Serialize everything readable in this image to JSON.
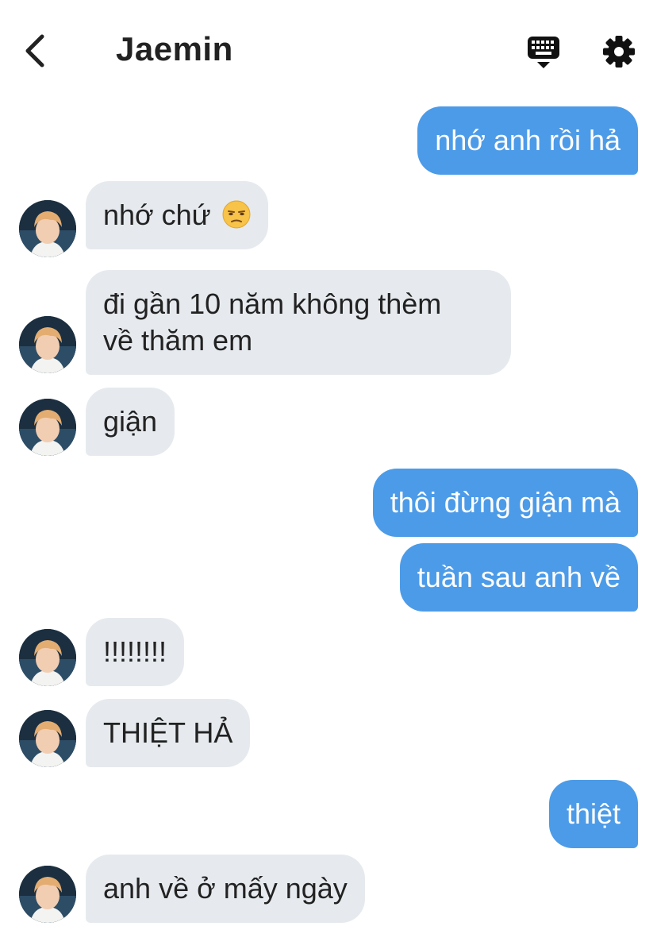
{
  "header": {
    "title": "Jaemin",
    "back_icon": "chevron-left-icon",
    "keyboard_icon": "keyboard-icon",
    "settings_icon": "gear-icon"
  },
  "colors": {
    "sent_bubble": "#4c9be8",
    "received_bubble": "#e6eaee",
    "text_dark": "#222222"
  },
  "messages": [
    {
      "from": "me",
      "text": "nhớ anh rồi hả"
    },
    {
      "from": "them",
      "text": "nhớ chứ",
      "emoji": "unamused-face-emoji"
    },
    {
      "from": "them",
      "text_line1": "đi gần 10 năm không thèm",
      "text_line2": "về thăm em"
    },
    {
      "from": "them",
      "text": "giận"
    },
    {
      "from": "me",
      "text": "thôi đừng giận mà"
    },
    {
      "from": "me",
      "text": "tuần sau anh về"
    },
    {
      "from": "them",
      "text": "!!!!!!!!"
    },
    {
      "from": "them",
      "text": "THIỆT HẢ"
    },
    {
      "from": "me",
      "text": "thiệt"
    },
    {
      "from": "them",
      "text": "anh về ở mấy ngày"
    }
  ]
}
